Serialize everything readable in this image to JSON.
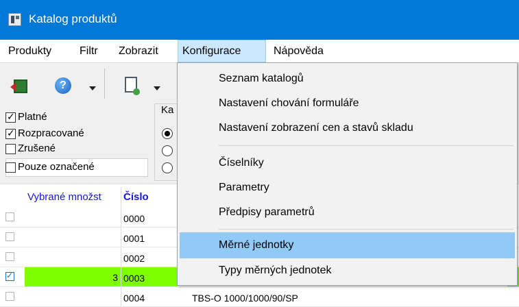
{
  "window": {
    "title": "Katalog produktů"
  },
  "menubar": {
    "items": [
      {
        "label": "Produkty"
      },
      {
        "label": "Filtr"
      },
      {
        "label": "Zobrazit"
      },
      {
        "label": "Konfigurace"
      },
      {
        "label": "Nápověda"
      }
    ]
  },
  "toolbar": {
    "help_glyph": "?",
    "icons": [
      "exit-icon",
      "help-icon",
      "new-document-icon",
      "chevron-down-icon"
    ]
  },
  "filter": {
    "checkboxes": [
      {
        "label": "Platné",
        "checked": true
      },
      {
        "label": "Rozpracované",
        "checked": true
      },
      {
        "label": "Zrušené",
        "checked": false
      },
      {
        "label": "Pouze označené",
        "checked": false
      }
    ],
    "group_title": "Ka"
  },
  "grid": {
    "columns": {
      "selected_qty": "Vybrané množst",
      "code": "Číslo"
    },
    "rows": [
      {
        "checked": false,
        "qty": "",
        "code": "0000",
        "name": ""
      },
      {
        "checked": false,
        "qty": "",
        "code": "0001",
        "name": ""
      },
      {
        "checked": false,
        "qty": "",
        "code": "0002",
        "name": ""
      },
      {
        "checked": true,
        "qty": "3",
        "code": "0003",
        "name": ""
      },
      {
        "checked": false,
        "qty": "",
        "code": "0004",
        "name": "TBS-O 1000/1000/90/SP"
      }
    ],
    "highlight_color": "#80ff00"
  },
  "dropdown": {
    "items": [
      {
        "label": "Seznam katalogů"
      },
      {
        "label": "Nastavení chování formuláře"
      },
      {
        "label": "Nastavení zobrazení cen a stavů skladu"
      },
      {
        "label": "Číselníky"
      },
      {
        "label": "Parametry"
      },
      {
        "label": "Předpisy parametrů"
      },
      {
        "label": "Měrné jednotky"
      },
      {
        "label": "Typy měrných jednotek"
      }
    ],
    "hovered_index": 6
  },
  "colors": {
    "titlebar": "#0078d7",
    "menu_active": "#cce8ff",
    "dropdown_hover": "#91c9f7",
    "grid_header_text": "#1818d8"
  }
}
